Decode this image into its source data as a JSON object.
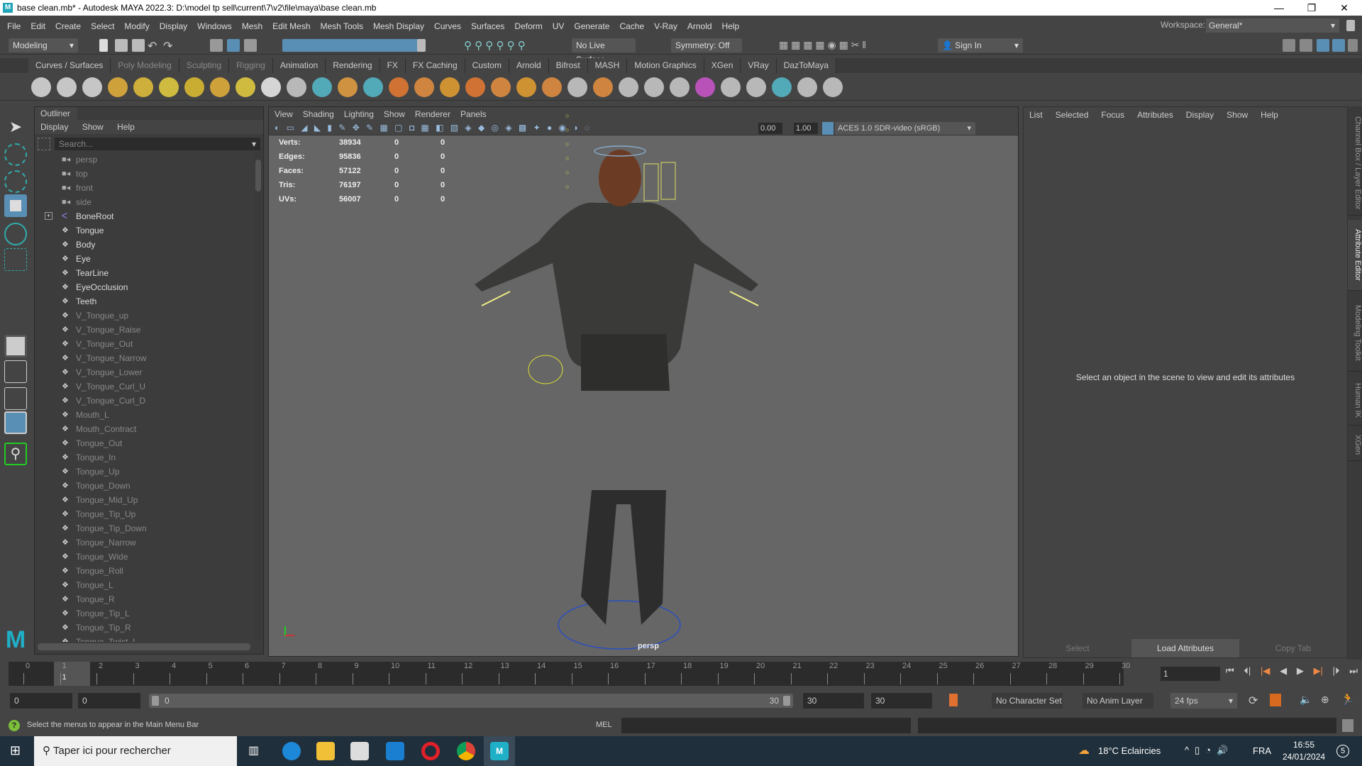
{
  "window": {
    "title": "base clean.mb* - Autodesk MAYA 2022.3: D:\\model tp sell\\current\\7\\v2\\file\\maya\\base clean.mb",
    "logo": "M",
    "minimize": "—",
    "restore": "❐",
    "close": "✕"
  },
  "menubar": [
    "File",
    "Edit",
    "Create",
    "Select",
    "Modify",
    "Display",
    "Windows",
    "Mesh",
    "Edit Mesh",
    "Mesh Tools",
    "Mesh Display",
    "Curves",
    "Surfaces",
    "Deform",
    "UV",
    "Generate",
    "Cache",
    "V-Ray",
    "Arnold",
    "Help"
  ],
  "workspace": {
    "label": "Workspace:",
    "value": "General*"
  },
  "statusline": {
    "menuset": "Modeling",
    "live_surface": "No Live Surface",
    "symmetry": "Symmetry: Off",
    "sign_in": "Sign In"
  },
  "shelf_tabs": [
    "Curves / Surfaces",
    "Poly Modeling",
    "Sculpting",
    "Rigging",
    "Animation",
    "Rendering",
    "FX",
    "FX Caching",
    "Custom",
    "Arnold",
    "Bifrost",
    "MASH",
    "Motion Graphics",
    "XGen",
    "VRay",
    "DazToMaya"
  ],
  "outliner": {
    "title": "Outliner",
    "menu": [
      "Display",
      "Show",
      "Help"
    ],
    "search_placeholder": "Search...",
    "items": [
      {
        "name": "persp",
        "type": "camera"
      },
      {
        "name": "top",
        "type": "camera"
      },
      {
        "name": "front",
        "type": "camera"
      },
      {
        "name": "side",
        "type": "camera"
      },
      {
        "name": "BoneRoot",
        "type": "joint"
      },
      {
        "name": "Tongue",
        "type": "mesh"
      },
      {
        "name": "Body",
        "type": "mesh"
      },
      {
        "name": "Eye",
        "type": "mesh"
      },
      {
        "name": "TearLine",
        "type": "mesh"
      },
      {
        "name": "EyeOcclusion",
        "type": "mesh"
      },
      {
        "name": "Teeth",
        "type": "mesh"
      },
      {
        "name": "V_Tongue_up",
        "type": "hidden"
      },
      {
        "name": "V_Tongue_Raise",
        "type": "hidden"
      },
      {
        "name": "V_Tongue_Out",
        "type": "hidden"
      },
      {
        "name": "V_Tongue_Narrow",
        "type": "hidden"
      },
      {
        "name": "V_Tongue_Lower",
        "type": "hidden"
      },
      {
        "name": "V_Tongue_Curl_U",
        "type": "hidden"
      },
      {
        "name": "V_Tongue_Curl_D",
        "type": "hidden"
      },
      {
        "name": "Mouth_L",
        "type": "hidden"
      },
      {
        "name": "Mouth_Contract",
        "type": "hidden"
      },
      {
        "name": "Tongue_Out",
        "type": "hidden"
      },
      {
        "name": "Tongue_In",
        "type": "hidden"
      },
      {
        "name": "Tongue_Up",
        "type": "hidden"
      },
      {
        "name": "Tongue_Down",
        "type": "hidden"
      },
      {
        "name": "Tongue_Mid_Up",
        "type": "hidden"
      },
      {
        "name": "Tongue_Tip_Up",
        "type": "hidden"
      },
      {
        "name": "Tongue_Tip_Down",
        "type": "hidden"
      },
      {
        "name": "Tongue_Narrow",
        "type": "hidden"
      },
      {
        "name": "Tongue_Wide",
        "type": "hidden"
      },
      {
        "name": "Tongue_Roll",
        "type": "hidden"
      },
      {
        "name": "Tongue_L",
        "type": "hidden"
      },
      {
        "name": "Tongue_R",
        "type": "hidden"
      },
      {
        "name": "Tongue_Tip_L",
        "type": "hidden"
      },
      {
        "name": "Tongue_Tip_R",
        "type": "hidden"
      },
      {
        "name": "Tongue_Twist_L",
        "type": "hidden"
      }
    ]
  },
  "viewport": {
    "menu": [
      "View",
      "Shading",
      "Lighting",
      "Show",
      "Renderer",
      "Panels"
    ],
    "exposure": "0.00",
    "gamma": "1.00",
    "colorspace": "ACES 1.0 SDR-video (sRGB)",
    "camera_label": "persp",
    "hud": [
      {
        "k": "Verts:",
        "v": "38934",
        "a": "0",
        "b": "0"
      },
      {
        "k": "Edges:",
        "v": "95836",
        "a": "0",
        "b": "0"
      },
      {
        "k": "Faces:",
        "v": "57122",
        "a": "0",
        "b": "0"
      },
      {
        "k": "Tris:",
        "v": "76197",
        "a": "0",
        "b": "0"
      },
      {
        "k": "UVs:",
        "v": "56007",
        "a": "0",
        "b": "0"
      }
    ]
  },
  "attribute_editor": {
    "menu": [
      "List",
      "Selected",
      "Focus",
      "Attributes",
      "Display",
      "Show",
      "Help"
    ],
    "message": "Select an object in the scene to view and edit its attributes",
    "buttons": [
      "Select",
      "Load Attributes",
      "Copy Tab"
    ]
  },
  "side_tabs": [
    "Channel Box / Layer Editor",
    "Attribute Editor",
    "Modeling Toolkit",
    "Human IK",
    "XGen"
  ],
  "timeline": {
    "ticks": [
      "0",
      "1",
      "2",
      "3",
      "4",
      "5",
      "6",
      "7",
      "8",
      "9",
      "10",
      "11",
      "12",
      "13",
      "14",
      "15",
      "16",
      "17",
      "18",
      "19",
      "20",
      "21",
      "22",
      "23",
      "24",
      "25",
      "26",
      "27",
      "28",
      "29",
      "30"
    ],
    "current_frame": "1",
    "current_field": "1"
  },
  "range": {
    "start": "0",
    "anim_start": "0",
    "slider_start": "0",
    "slider_end": "30",
    "anim_end": "30",
    "end": "30",
    "character_set": "No Character Set",
    "anim_layer": "No Anim Layer",
    "fps": "24 fps"
  },
  "command": {
    "help": "Select the menus to appear in the Main Menu Bar",
    "lang": "MEL"
  },
  "taskbar": {
    "search": "Taper ici pour rechercher",
    "weather": "18°C  Eclaircies",
    "lang": "FRA",
    "time": "16:55",
    "date": "24/01/2024",
    "notif": "5"
  }
}
